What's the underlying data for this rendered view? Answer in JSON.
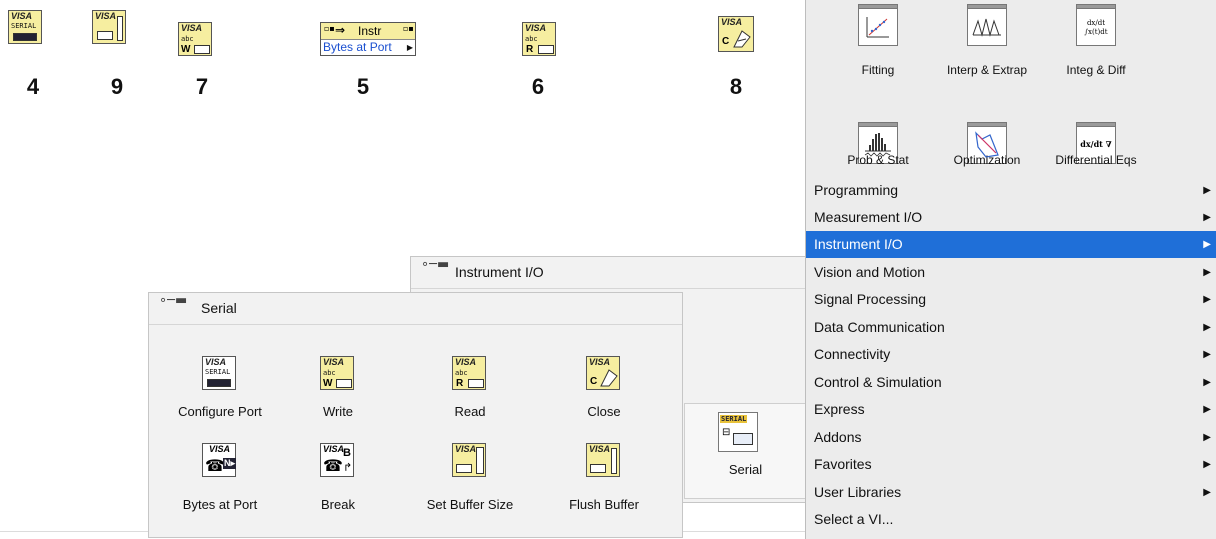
{
  "block_diagram": {
    "nodes": [
      {
        "number": "4",
        "icon": "visa-configure-serial-port-icon",
        "visa_text": "VISA",
        "sub_text": "SERIAL"
      },
      {
        "number": "9",
        "icon": "visa-flush-buffer-icon",
        "visa_text": "VISA"
      },
      {
        "number": "7",
        "icon": "visa-write-icon",
        "visa_text": "VISA",
        "sub_text": "abc",
        "letter": "W"
      },
      {
        "number": "5",
        "icon": "bytes-at-port-property-node-icon",
        "instr_label": "Instr",
        "property_label": "Bytes at Port"
      },
      {
        "number": "6",
        "icon": "visa-read-icon",
        "visa_text": "VISA",
        "sub_text": "abc",
        "letter": "R"
      },
      {
        "number": "8",
        "icon": "visa-close-icon",
        "visa_text": "VISA",
        "letter": "C"
      }
    ]
  },
  "functions_palette": {
    "math_tiles": [
      {
        "label": "Fitting",
        "icon": "fitting-icon"
      },
      {
        "label": "Interp & Extrap",
        "icon": "interp-extrap-icon"
      },
      {
        "label": "Integ & Diff",
        "icon": "integ-diff-icon",
        "glyph_text": "dx/dt ∫x(t)dt"
      },
      {
        "label": "Prob & Stat",
        "icon": "histogram-icon"
      },
      {
        "label": "Optimization",
        "icon": "optimization-icon"
      },
      {
        "label": "Differential Eqs",
        "icon": "differential-eqs-icon",
        "glyph_text": "dx/dt ∇"
      }
    ],
    "categories": [
      {
        "label": "Programming",
        "has_submenu": true,
        "selected": false
      },
      {
        "label": "Measurement I/O",
        "has_submenu": true,
        "selected": false
      },
      {
        "label": "Instrument I/O",
        "has_submenu": true,
        "selected": true
      },
      {
        "label": "Vision and Motion",
        "has_submenu": true,
        "selected": false
      },
      {
        "label": "Signal Processing",
        "has_submenu": true,
        "selected": false
      },
      {
        "label": "Data Communication",
        "has_submenu": true,
        "selected": false
      },
      {
        "label": "Connectivity",
        "has_submenu": true,
        "selected": false
      },
      {
        "label": "Control & Simulation",
        "has_submenu": true,
        "selected": false
      },
      {
        "label": "Express",
        "has_submenu": true,
        "selected": false
      },
      {
        "label": "Addons",
        "has_submenu": true,
        "selected": false
      },
      {
        "label": "Favorites",
        "has_submenu": true,
        "selected": false
      },
      {
        "label": "User Libraries",
        "has_submenu": true,
        "selected": false
      },
      {
        "label": "Select a VI...",
        "has_submenu": false,
        "selected": false
      }
    ],
    "selected_color": "#1f6fd8"
  },
  "instrument_io_palette": {
    "title": "Instrument I/O",
    "pin_icon": "pin-icon",
    "serial_tile": {
      "label": "Serial",
      "badge": "SERIAL",
      "icon": "serial-palette-icon"
    }
  },
  "serial_palette": {
    "title": "Serial",
    "pin_icon": "pin-icon",
    "items": [
      {
        "label": "Configure Port",
        "icon": "visa-configure-serial-port-icon"
      },
      {
        "label": "Write",
        "icon": "visa-write-icon"
      },
      {
        "label": "Read",
        "icon": "visa-read-icon"
      },
      {
        "label": "Close",
        "icon": "visa-close-icon"
      },
      {
        "label": "Bytes at Port",
        "icon": "visa-bytes-at-port-icon"
      },
      {
        "label": "Break",
        "icon": "visa-break-icon"
      },
      {
        "label": "Set Buffer Size",
        "icon": "visa-set-buffer-size-icon"
      },
      {
        "label": "Flush Buffer",
        "icon": "visa-flush-buffer-icon"
      }
    ]
  },
  "colors": {
    "visa_icon_bg": "#f6eea0",
    "palette_bg": "#ececec",
    "link_blue": "#1a4fd0"
  }
}
